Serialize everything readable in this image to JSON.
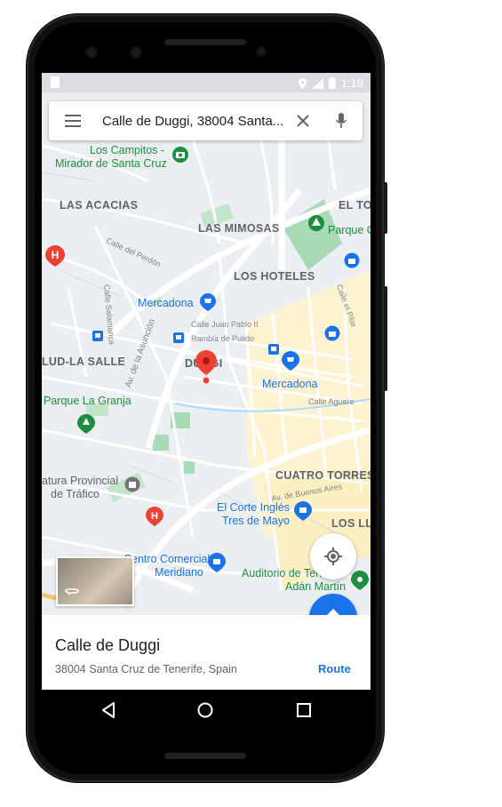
{
  "status": {
    "time": "1:19"
  },
  "search": {
    "query": "Calle de Duggi, 38004 Santa..."
  },
  "map": {
    "labels": {
      "los_campitos": "Los Campitos -",
      "mirador": "Mirador de Santa Cruz",
      "las_acacias": "LAS ACACIAS",
      "el_to": "EL TO",
      "las_mimosas": "LAS MIMOSAS",
      "parque_c": "Parque C",
      "los_hoteles": "LOS HOTELES",
      "mercadona_1": "Mercadona",
      "mercadona_2": "Mercadona",
      "salud_la_salle": "LUD-LA SALLE",
      "duggi": "DUGGI",
      "parque_la_granja": "Parque La Granja",
      "jefatura": "atura Provincial",
      "trafico": "de Tráfico",
      "cuatro_torres": "CUATRO TORRES",
      "el_corte_ingles": "El Corte Inglés",
      "tres_de_mayo": "Tres de Mayo",
      "los_ll": "LOS LL",
      "centro_comercial": "Centro Comercial",
      "meridiano": "Meridiano",
      "auditorio": "Auditorio de Tenerife",
      "adan_martin": "Adán Martín",
      "calle_del_perdon": "Calle del Perdón",
      "calle_salamanca": "Calle Salamanca",
      "av_de_la_asuncion": "Av. de la Asunción",
      "calle_juan_pablo": "Calle Juan Pablo II",
      "rambla_de_pulido": "Rambla de Pulido",
      "av_de_buenos_aires": "Av. de Buenos Aires",
      "calle_aguere": "Calle Aguere",
      "calle_el_pilar": "Calle el Pilar"
    }
  },
  "place": {
    "name": "Calle de Duggi",
    "address": "38004 Santa Cruz de Tenerife, Spain",
    "route_label": "Route"
  },
  "colors": {
    "accent": "#1a73e8",
    "pin": "#ea4335",
    "park": "#a8dab5",
    "yellow_zone": "#fdf3d0"
  },
  "icons": [
    "menu-icon",
    "close-icon",
    "mic-icon",
    "my-location-icon",
    "directions-icon",
    "back-icon",
    "home-icon",
    "recents-icon",
    "location-pin-icon"
  ]
}
